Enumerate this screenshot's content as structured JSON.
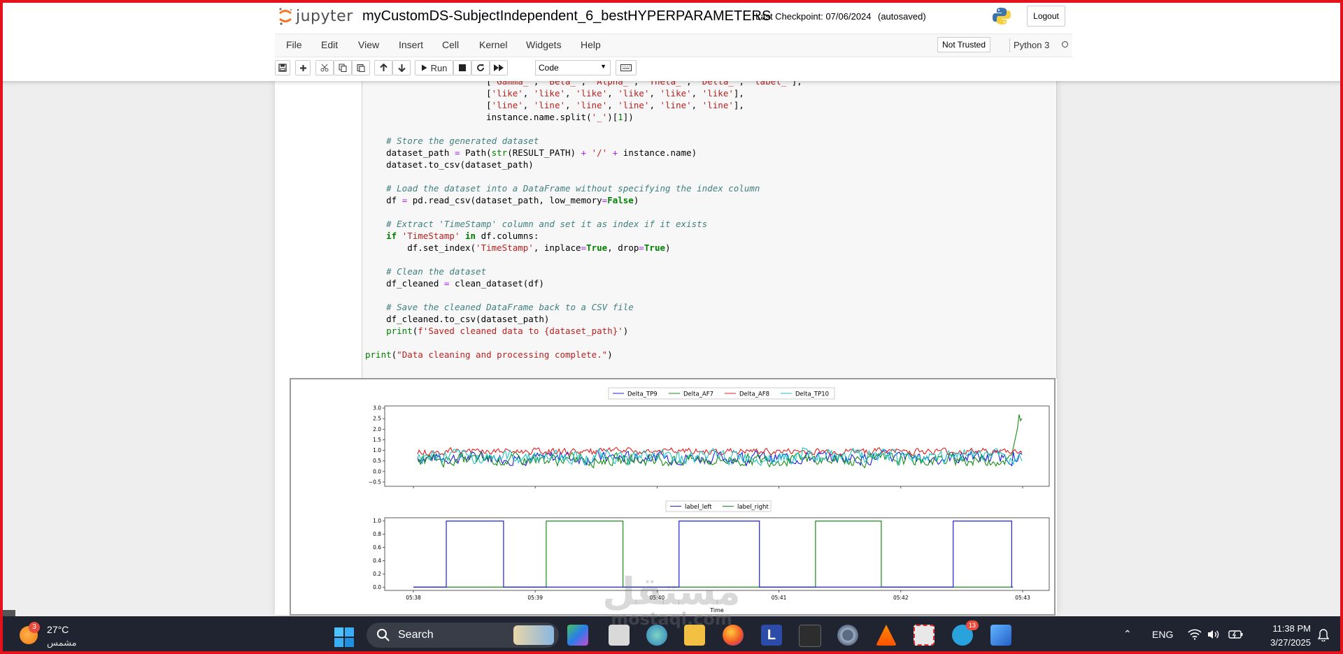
{
  "header": {
    "logo_text": "jupyter",
    "notebook_name": "myCustomDS-SubjectIndependent_6_bestHYPERPARAMETERS",
    "checkpoint": "Last Checkpoint: 07/06/2024",
    "autosave": "(autosaved)",
    "logout": "Logout"
  },
  "menu": {
    "items": [
      "File",
      "Edit",
      "View",
      "Insert",
      "Cell",
      "Kernel",
      "Widgets",
      "Help"
    ],
    "trust": "Not Trusted",
    "kernel": "Python 3"
  },
  "toolbar": {
    "run_label": "Run",
    "cell_type": "Code",
    "icons": [
      "save-icon",
      "add-icon",
      "cut-icon",
      "copy-icon",
      "paste-icon",
      "move-up-icon",
      "move-down-icon",
      "play-icon",
      "stop-icon",
      "restart-icon",
      "fast-forward-icon",
      "keyboard-icon"
    ]
  },
  "code_lines": [
    "                       ['Gamma_', 'Beta_', 'Alpha_', 'Theta_', 'Delta_', 'label_'],",
    "                       ['like', 'like', 'like', 'like', 'like', 'like'],",
    "                       ['line', 'line', 'line', 'line', 'line', 'line'],",
    "                       instance.name.split('_')[1])",
    "",
    "    # Store the generated dataset",
    "    dataset_path = Path(str(RESULT_PATH) + '/' + instance.name)",
    "    dataset.to_csv(dataset_path)",
    "",
    "    # Load the dataset into a DataFrame without specifying the index column",
    "    df = pd.read_csv(dataset_path, low_memory=False)",
    "",
    "    # Extract 'TimeStamp' column and set it as index if it exists",
    "    if 'TimeStamp' in df.columns:",
    "        df.set_index('TimeStamp', inplace=True, drop=True)",
    "",
    "    # Clean the dataset",
    "    df_cleaned = clean_dataset(df)",
    "",
    "    # Save the cleaned DataFrame back to a CSV file",
    "    df_cleaned.to_csv(dataset_path)",
    "    print(f'Saved cleaned data to {dataset_path}')",
    "",
    "print(\"Data cleaning and processing complete.\")"
  ],
  "chart_data": [
    {
      "type": "line",
      "legend": "top-center",
      "series_names": [
        "Delta_TP9",
        "Delta_AF7",
        "Delta_AF8",
        "Delta_TP10"
      ],
      "colors": [
        "#1f1fe0",
        "#1a8c1a",
        "#e01f1f",
        "#1fc4c4"
      ],
      "ylim": [
        -0.7,
        3.1
      ],
      "yticks": [
        -0.5,
        0.0,
        0.5,
        1.0,
        1.5,
        2.0,
        2.5,
        3.0
      ],
      "ytick_labels": [
        "−0.5",
        "0.0",
        "0.5",
        "1.0",
        "1.5",
        "2.0",
        "2.5",
        "3.0"
      ],
      "note": "approximate signal traces ~0.2–1.5 with spike to ~2.8 at end of Delta_AF7"
    },
    {
      "type": "line",
      "legend": "top-center",
      "series_names": [
        "label_left",
        "label_right"
      ],
      "colors": [
        "#1f1fe0",
        "#1a8c1a"
      ],
      "ylim": [
        -0.05,
        1.05
      ],
      "yticks": [
        0.0,
        0.2,
        0.4,
        0.6,
        0.8,
        1.0
      ],
      "ytick_labels": [
        "0.0",
        "0.2",
        "0.4",
        "0.6",
        "0.8",
        "1.0"
      ],
      "x_tick_labels": [
        "05:38",
        "05:39",
        "05:40",
        "05:41",
        "05:42",
        "05:43"
      ],
      "xlabel": "Time",
      "label_left_on": [
        [
          0.27,
          0.74
        ],
        [
          2.18,
          2.84
        ],
        [
          4.43,
          4.91
        ]
      ],
      "label_right_on": [
        [
          1.09,
          1.72
        ],
        [
          3.3,
          3.84
        ]
      ],
      "x_end": 4.92
    }
  ],
  "watermark": {
    "arabic": "مستقل",
    "latin": "mostaql.com"
  },
  "taskbar": {
    "weather_badge": "3",
    "temperature": "27°C",
    "condition": "مشمس",
    "search": "Search",
    "language": "ENG",
    "time": "11:38 PM",
    "date": "3/27/2025",
    "telegram_badge": "13"
  }
}
